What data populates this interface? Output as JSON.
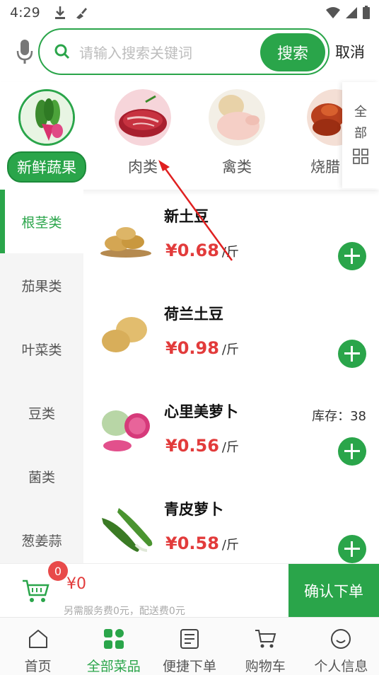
{
  "status": {
    "time": "4:29",
    "icons": [
      "download-icon",
      "brush-icon",
      "wifi-icon",
      "signal-icon",
      "battery-icon"
    ]
  },
  "search": {
    "placeholder": "请输入搜索关键词",
    "button": "搜索",
    "cancel": "取消"
  },
  "categories": [
    {
      "label": "新鲜蔬果",
      "active": true
    },
    {
      "label": "肉类",
      "active": false
    },
    {
      "label": "禽类",
      "active": false
    },
    {
      "label": "烧腊",
      "active": false
    }
  ],
  "all_categories_label": [
    "全",
    "部"
  ],
  "sidebar": [
    {
      "label": "根茎类",
      "active": true
    },
    {
      "label": "茄果类"
    },
    {
      "label": "叶菜类"
    },
    {
      "label": "豆类"
    },
    {
      "label": "菌类"
    },
    {
      "label": "葱姜蒜"
    }
  ],
  "products": [
    {
      "name": "新土豆",
      "price": "¥0.68",
      "unit": "/斤",
      "stock": ""
    },
    {
      "name": "荷兰土豆",
      "price": "¥0.98",
      "unit": "/斤",
      "stock": ""
    },
    {
      "name": "心里美萝卜",
      "price": "¥0.56",
      "unit": "/斤",
      "stock": "库存：38"
    },
    {
      "name": "青皮萝卜",
      "price": "¥0.58",
      "unit": "/斤",
      "stock": ""
    }
  ],
  "cart": {
    "count": "0",
    "total": "¥0",
    "note": "另需服务费0元，配送费0元",
    "confirm": "确认下单"
  },
  "nav": [
    {
      "label": "首页",
      "icon": "home-icon"
    },
    {
      "label": "全部菜品",
      "icon": "grid-icon",
      "active": true
    },
    {
      "label": "便捷下单",
      "icon": "order-icon"
    },
    {
      "label": "购物车",
      "icon": "cart-icon"
    },
    {
      "label": "个人信息",
      "icon": "smile-icon"
    }
  ],
  "colors": {
    "accent": "#2aa54a",
    "price": "#e23b3b",
    "annotation": "#e02020"
  }
}
